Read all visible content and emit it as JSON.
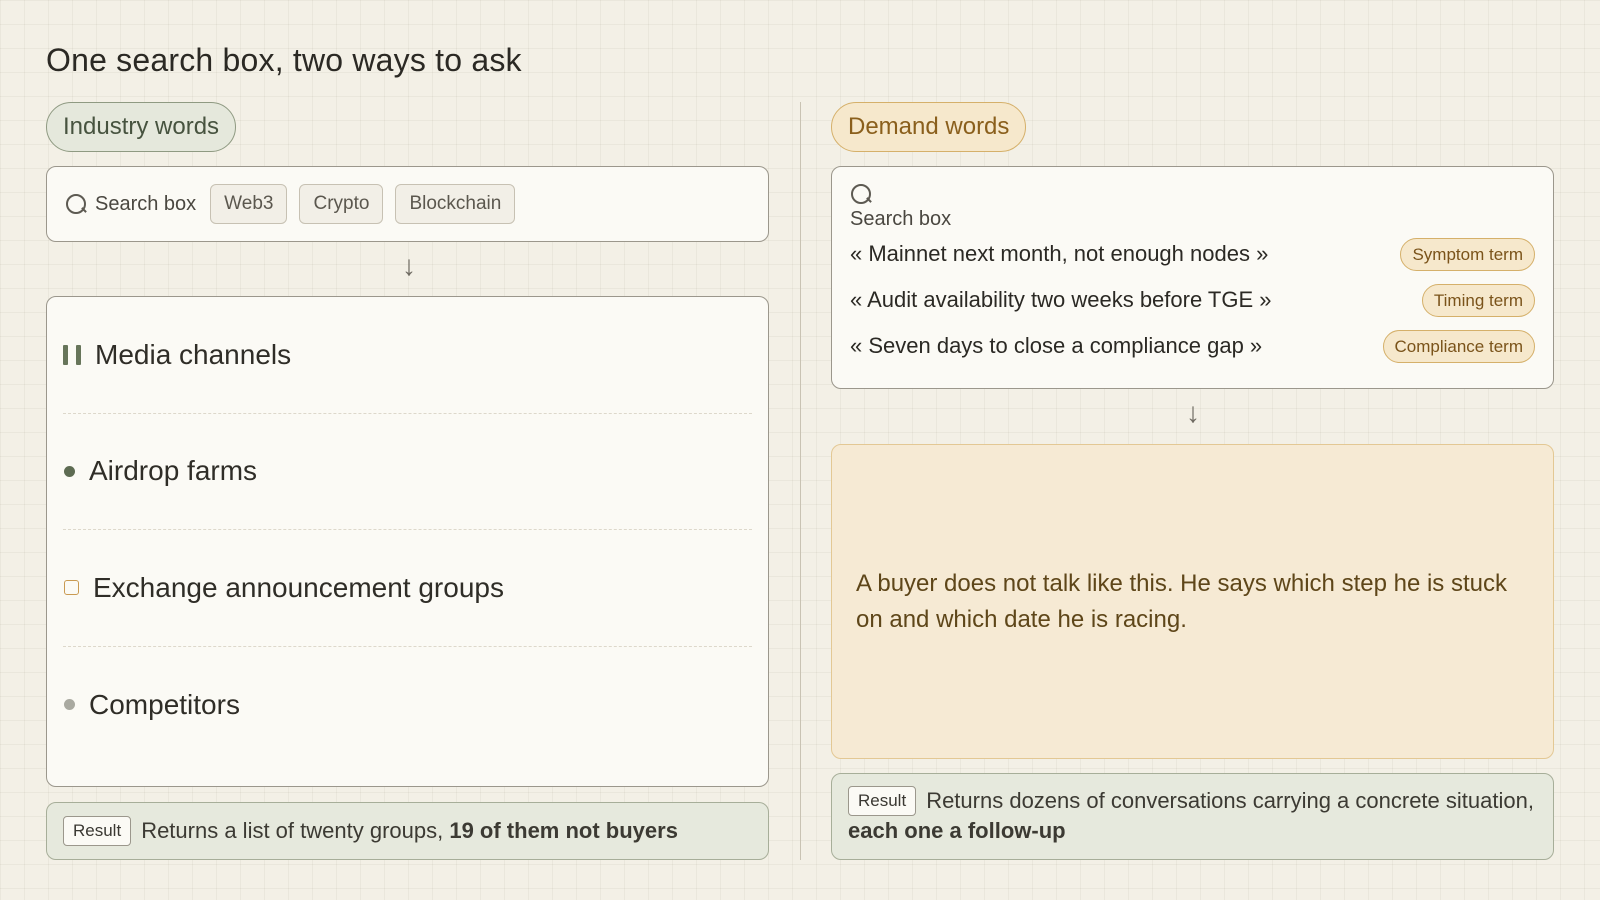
{
  "title": "One search box, two ways to ask",
  "left": {
    "pill": "Industry words",
    "search": {
      "label": "Search box",
      "tags": [
        "Web3",
        "Crypto",
        "Blockchain"
      ]
    },
    "arrow": "↓",
    "list": [
      {
        "text": "Media channels",
        "marker": "bars"
      },
      {
        "text": "Airdrop farms",
        "marker": "dot"
      },
      {
        "text": "Exchange announcement groups",
        "marker": "square"
      },
      {
        "text": "Competitors",
        "marker": "grey-dot"
      }
    ],
    "result": {
      "badge": "Result",
      "text": "Returns a list of twenty groups,",
      "strong": "19 of them not buyers"
    }
  },
  "right": {
    "pill": "Demand words",
    "search": {
      "label": "Search box",
      "queries": [
        {
          "text": "« Mainnet next month, not enough nodes »",
          "chip": "Symptom term"
        },
        {
          "text": "« Audit availability two weeks before TGE »",
          "chip": "Timing term"
        },
        {
          "text": "« Seven days to close a compliance gap »",
          "chip": "Compliance term"
        }
      ]
    },
    "arrow": "↓",
    "quote": "A buyer does not talk like this. He says which step he is stuck on and which date he is racing.",
    "result": {
      "badge": "Result",
      "text": "Returns dozens of conversations carrying a concrete situation,",
      "strong": "each one a follow-up"
    }
  },
  "colors": {
    "industry_accent": "#67755a",
    "demand_accent": "#d5b06a",
    "result_bg": "#e6e9dd",
    "quote_bg": "#f6ead4"
  }
}
